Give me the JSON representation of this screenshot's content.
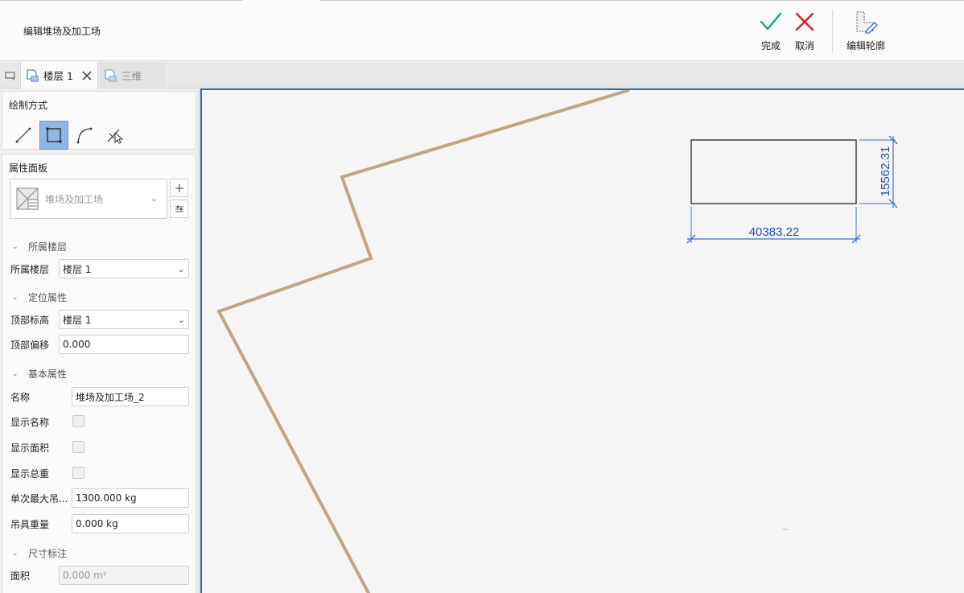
{
  "ribbon": {
    "title": "编辑堆场及加工场",
    "done_label": "完成",
    "cancel_label": "取消",
    "edit_outline_label": "编辑轮廓",
    "colors": {
      "done": "#1a9e8f",
      "cancel": "#d0232a"
    }
  },
  "tabs": [
    {
      "label": "楼层 1",
      "active": true
    },
    {
      "label": "三维",
      "active": false
    }
  ],
  "draw_panel": {
    "title": "绘制方式",
    "tools": [
      "line-tool-icon",
      "rectangle-tool-icon",
      "arc-tool-icon",
      "pick-tool-icon"
    ],
    "selected": "rectangle-tool-icon"
  },
  "prop_panel": {
    "title": "属性面板",
    "type_name": "堆场及加工场",
    "groups": {
      "floor": "所属楼层",
      "position": "定位属性",
      "basic": "基本属性",
      "dimension": "尺寸标注"
    },
    "fields": {
      "floor_label": "所属楼层",
      "floor_value": "楼层 1",
      "top_elev_label": "顶部标高",
      "top_elev_value": "楼层 1",
      "top_offset_label": "顶部偏移",
      "top_offset_value": "0.000",
      "name_label": "名称",
      "name_value": "堆场及加工场_2",
      "show_name_label": "显示名称",
      "show_area_label": "显示面积",
      "show_weight_label": "显示总重",
      "max_lift_label": "单次最大吊...",
      "max_lift_value": "1300.000 kg",
      "rigging_weight_label": "吊具重量",
      "rigging_weight_value": "0.000 kg",
      "area_label": "面积",
      "area_value": "0.000 m²"
    }
  },
  "canvas": {
    "dim_width": "40383.22",
    "dim_height": "15562.31",
    "colors": {
      "boundary": "#c2a583",
      "dimension": "#3a6fd0",
      "dim_text": "#1e4fb5",
      "rect": "#333333"
    }
  }
}
